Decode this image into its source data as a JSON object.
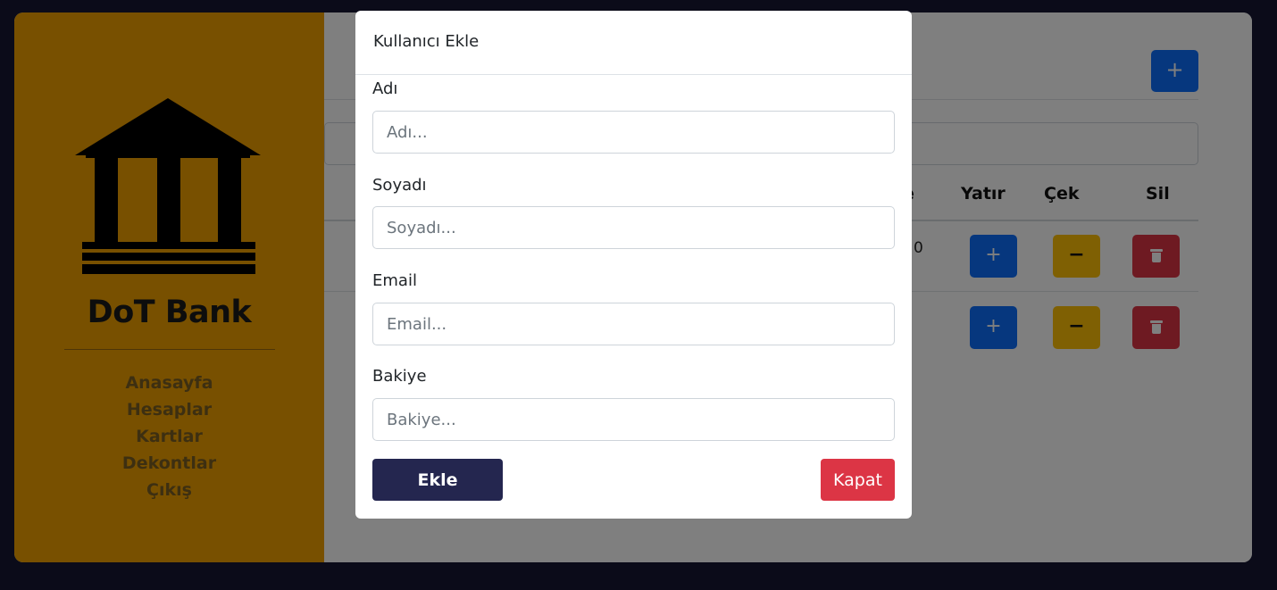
{
  "sidebar": {
    "brand": "DoT Bank",
    "nav_items": [
      {
        "label": "Anasayfa"
      },
      {
        "label": "Hesaplar"
      },
      {
        "label": "Kartlar"
      },
      {
        "label": "Dekontlar"
      },
      {
        "label": "Çıkış"
      }
    ]
  },
  "main": {
    "add_button_icon": "+",
    "table": {
      "headers_visible": [
        "e",
        "Yatır",
        "Çek",
        "Sil"
      ],
      "rows": [
        {
          "partial_value": "0",
          "deposit_icon": "+",
          "withdraw_icon": "−",
          "delete_icon": "trash-icon"
        },
        {
          "partial_value": "",
          "deposit_icon": "+",
          "withdraw_icon": "−",
          "delete_icon": "trash-icon"
        }
      ]
    }
  },
  "modal": {
    "title": "Kullanıcı Ekle",
    "fields": [
      {
        "label": "Adı",
        "placeholder": "Adı...",
        "value": ""
      },
      {
        "label": "Soyadı",
        "placeholder": "Soyadı...",
        "value": ""
      },
      {
        "label": "Email",
        "placeholder": "Email...",
        "value": ""
      },
      {
        "label": "Bakiye",
        "placeholder": "Bakiye...",
        "value": ""
      }
    ],
    "submit_label": "Ekle",
    "close_label": "Kapat"
  },
  "colors": {
    "page_bg": "#161632",
    "sidebar_bg": "#f0a000",
    "primary": "#0d6efd",
    "warning": "#ffc107",
    "danger": "#dc3545",
    "submit": "#24264f"
  }
}
